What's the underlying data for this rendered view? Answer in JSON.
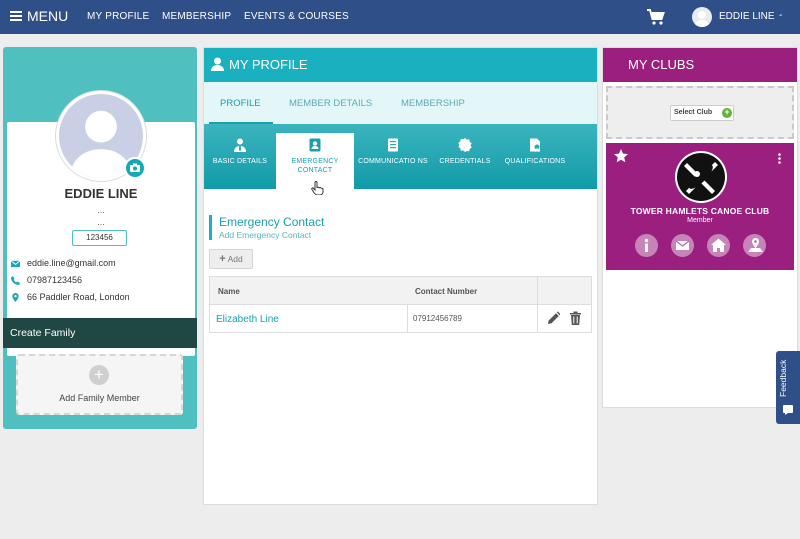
{
  "topbar": {
    "menu_label": "MENU",
    "nav": [
      "MY PROFILE",
      "MEMBERSHIP",
      "EVENTS & COURSES"
    ],
    "user_name": "EDDIE LINE",
    "caret": "-"
  },
  "profile": {
    "name": "EDDIE LINE",
    "line1": "...",
    "line2": "...",
    "member_number": "123456",
    "email": "eddie.line@gmail.com",
    "phone": "07987123456",
    "address": "66 Paddler Road, London"
  },
  "family": {
    "title": "Create Family",
    "add_label": "Add Family Member"
  },
  "main": {
    "title": "MY PROFILE",
    "tabs": [
      "PROFILE",
      "MEMBER DETAILS",
      "MEMBERSHIP"
    ],
    "subtabs": [
      {
        "label": "BASIC DETAILS",
        "icon": "user-tie-icon"
      },
      {
        "label": "EMERGENCY CONTACT",
        "icon": "contact-card-icon"
      },
      {
        "label": "COMMUNICATIO NS",
        "icon": "document-icon"
      },
      {
        "label": "CREDENTIALS",
        "icon": "badge-icon"
      },
      {
        "label": "QUALIFICATIONS",
        "icon": "certificate-icon"
      }
    ],
    "section_title": "Emergency Contact",
    "section_subtitle": "Add Emergency Contact",
    "add_button": "Add",
    "table": {
      "headers": [
        "Name",
        "Contact Number"
      ],
      "rows": [
        {
          "name": "Elizabeth Line",
          "number": "07912456789"
        }
      ]
    }
  },
  "clubs": {
    "title": "MY CLUBS",
    "select_label": "Select Club",
    "club": {
      "name": "TOWER HAMLETS CANOE CLUB",
      "role": "Member",
      "actions": [
        "info-icon",
        "mail-icon",
        "home-icon",
        "map-pin-icon"
      ]
    }
  },
  "feedback": {
    "label": "Feedback"
  },
  "colors": {
    "navy": "#2f4f88",
    "teal": "#19b1bf",
    "magenta": "#9a1f7e"
  }
}
